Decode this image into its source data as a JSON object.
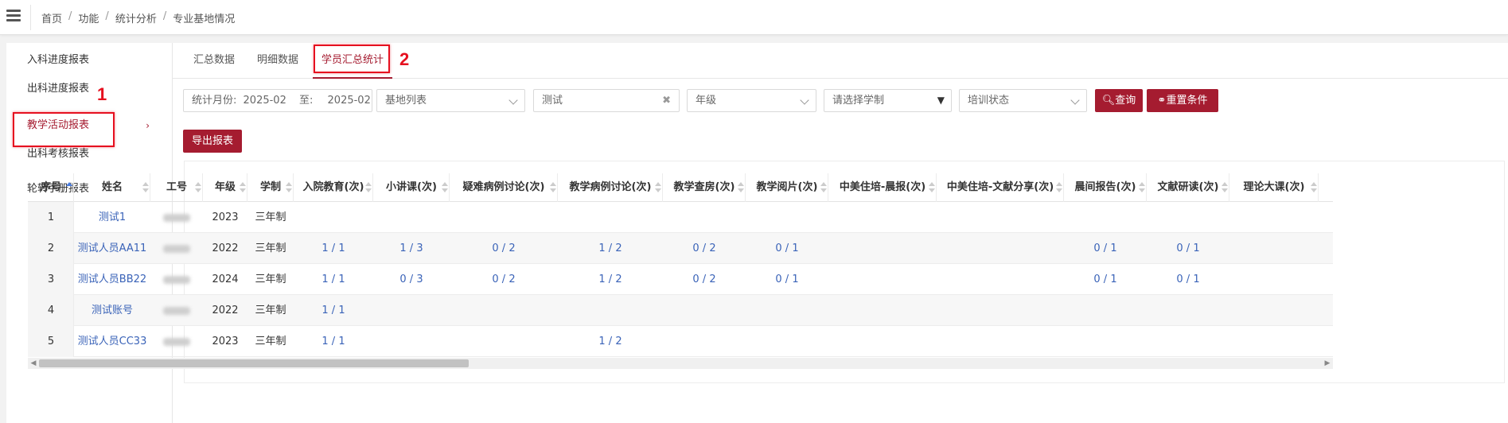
{
  "breadcrumb": {
    "items": [
      "首页",
      "功能",
      "统计分析",
      "专业基地情况"
    ],
    "separator": "/"
  },
  "sidebar": {
    "items": [
      {
        "label": "入科进度报表"
      },
      {
        "label": "出科进度报表"
      },
      {
        "label": "教学活动报表",
        "active": true,
        "chevron": "›"
      },
      {
        "label": "出科考核报表"
      },
      {
        "label": "轮转手册报表"
      }
    ]
  },
  "annotations": {
    "one": "1",
    "two": "2"
  },
  "tabs": [
    {
      "label": "汇总数据"
    },
    {
      "label": "明细数据"
    },
    {
      "label": "学员汇总统计",
      "active": true
    }
  ],
  "filters": {
    "month_label": "统计月份:",
    "month_from": "2025-02",
    "month_to_label": "至:",
    "month_to": "2025-02",
    "base_placeholder": "基地列表",
    "search_value": "测试",
    "clear_icon": "✖",
    "grade_placeholder": "年级",
    "system_placeholder": "请选择学制",
    "training_placeholder": "培训状态",
    "query_label": "查询",
    "reset_label": "重置条件",
    "export_label": "导出报表"
  },
  "table": {
    "headers": [
      "序号",
      "姓名",
      "工号",
      "年级",
      "学制",
      "入院教育(次)",
      "小讲课(次)",
      "疑难病例讨论(次)",
      "教学病例讨论(次)",
      "教学查房(次)",
      "教学阅片(次)",
      "中美住培-晨报(次)",
      "中美住培-文献分享(次)",
      "晨间报告(次)",
      "文献研读(次)",
      "理论大课(次)"
    ],
    "rows": [
      {
        "seq": "1",
        "name": "测试1",
        "grade": "2023",
        "system": "三年制",
        "c5": "",
        "c6": "",
        "c7": "",
        "c8": "",
        "c9": "",
        "c10": "",
        "c11": "",
        "c12": "",
        "c13": "",
        "c14": "",
        "c15": ""
      },
      {
        "seq": "2",
        "name": "测试人员AA11",
        "grade": "2022",
        "system": "三年制",
        "c5": "1 / 1",
        "c6": "1 / 3",
        "c7": "0 / 2",
        "c8": "1 / 2",
        "c9": "0 / 2",
        "c10": "0 / 1",
        "c11": "",
        "c12": "",
        "c13": "0 / 1",
        "c14": "0 / 1",
        "c15": ""
      },
      {
        "seq": "3",
        "name": "测试人员BB22",
        "grade": "2024",
        "system": "三年制",
        "c5": "1 / 1",
        "c6": "0 / 3",
        "c7": "0 / 2",
        "c8": "1 / 2",
        "c9": "0 / 2",
        "c10": "0 / 1",
        "c11": "",
        "c12": "",
        "c13": "0 / 1",
        "c14": "0 / 1",
        "c15": ""
      },
      {
        "seq": "4",
        "name": "测试账号",
        "grade": "2022",
        "system": "三年制",
        "c5": "1 / 1",
        "c6": "",
        "c7": "",
        "c8": "",
        "c9": "",
        "c10": "",
        "c11": "",
        "c12": "",
        "c13": "",
        "c14": "",
        "c15": ""
      },
      {
        "seq": "5",
        "name": "测试人员CC33",
        "grade": "2023",
        "system": "三年制",
        "c5": "1 / 1",
        "c6": "",
        "c7": "",
        "c8": "1 / 2",
        "c9": "",
        "c10": "",
        "c11": "",
        "c12": "",
        "c13": "",
        "c14": "",
        "c15": ""
      }
    ]
  },
  "colors": {
    "accent": "#a51c30",
    "link": "#3a63b8",
    "annotation": "#e6101f"
  },
  "icons": {
    "menu": "hamburger-icon",
    "search": "search-icon",
    "tag": "tag-icon",
    "sort": "sort-icon"
  }
}
